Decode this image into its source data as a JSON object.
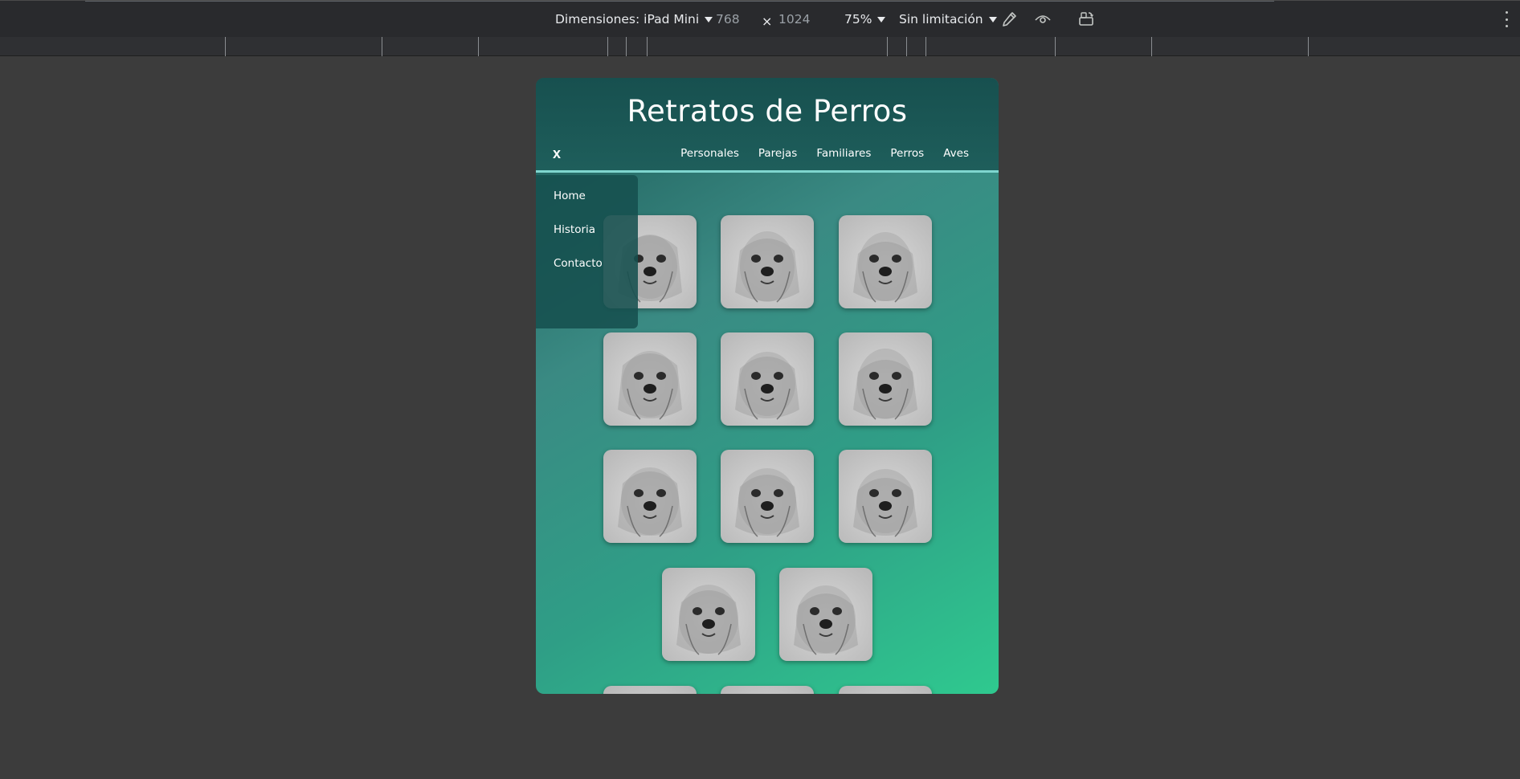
{
  "devtools": {
    "dimensions_label": "Dimensiones: iPad Mini",
    "width_value": "768",
    "times_symbol": "×",
    "height_value": "1024",
    "zoom": "75%",
    "throttle": "Sin limitación",
    "icons": [
      "color-picker-icon",
      "eye-icon",
      "rotate-device-icon",
      "more-vert-icon"
    ]
  },
  "site": {
    "title": "Retratos de Perros",
    "close_label": "x",
    "nav": [
      "Personales",
      "Parejas",
      "Familiares",
      "Perros",
      "Aves"
    ],
    "side_menu": [
      "Home",
      "Historia",
      "Contacto"
    ]
  },
  "gallery": {
    "images": [
      "dog-portrait-1",
      "dog-portrait-2",
      "dog-portrait-3",
      "dog-portrait-4",
      "dog-portrait-5",
      "dog-portrait-6",
      "dog-portrait-7",
      "dog-portrait-8",
      "dog-portrait-9",
      "dog-portrait-10",
      "dog-portrait-11",
      "dog-portrait-12",
      "dog-portrait-13",
      "dog-portrait-14"
    ]
  },
  "colors": {
    "header_bg": "#17504f",
    "accent_line": "#7fd6cf",
    "gradient_end": "#2fc98f",
    "devtools_bg": "#292a2d"
  }
}
